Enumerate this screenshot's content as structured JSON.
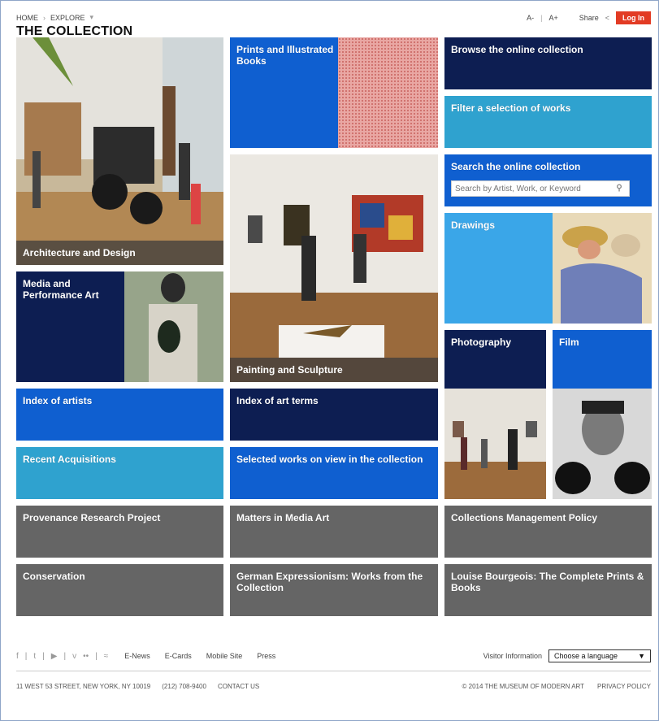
{
  "breadcrumb": {
    "home": "HOME",
    "explore": "EXPLORE"
  },
  "page_title": "THE COLLECTION",
  "tools": {
    "font_smaller": "A-",
    "font_larger": "A+",
    "share": "Share",
    "login": "Log In"
  },
  "tiles": {
    "architecture": "Architecture and Design",
    "prints": "Prints and Illustrated Books",
    "browse": "Browse the online collection",
    "filter": "Filter a selection of works",
    "search_title": "Search the online collection",
    "media": "Media and Performance Art",
    "painting": "Painting and Sculpture",
    "drawings": "Drawings",
    "photography": "Photography",
    "film": "Film",
    "index_artists": "Index of artists",
    "index_terms": "Index of art terms",
    "recent": "Recent Acquisitions",
    "selected": "Selected works on view in the collection",
    "provenance": "Provenance Research Project",
    "matters": "Matters in Media Art",
    "collections_policy": "Collections Management Policy",
    "conservation": "Conservation",
    "german": "German Expressionism: Works from the Collection",
    "bourgeois": "Louise Bourgeois: The Complete Prints & Books"
  },
  "search": {
    "placeholder": "Search by Artist, Work, or Keyword"
  },
  "footer": {
    "links": [
      "E-News",
      "E-Cards",
      "Mobile Site",
      "Press"
    ],
    "visitor_info": "Visitor Information",
    "language": "Choose a language",
    "address": "11 WEST 53 STREET, NEW YORK, NY 10019",
    "phone": "(212) 708-9400",
    "contact": "CONTACT US",
    "copyright": "© 2014 THE MUSEUM OF MODERN ART",
    "privacy": "PRIVACY POLICY"
  },
  "colors": {
    "navy": "#0d1e52",
    "blue": "#0f5fd0",
    "cyan": "#2fa2cf",
    "gray": "#656565",
    "login_red": "#e23b24"
  }
}
